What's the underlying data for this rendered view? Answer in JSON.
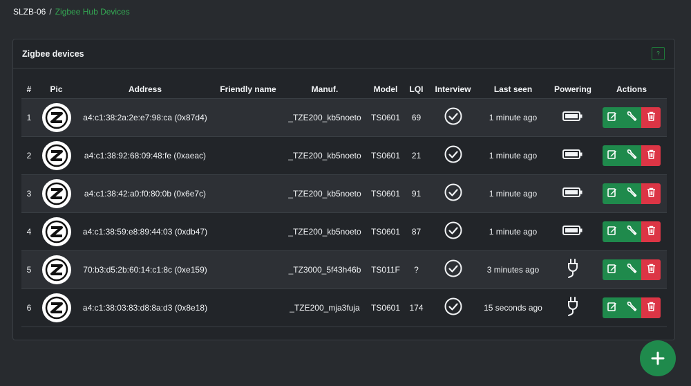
{
  "breadcrumb": {
    "root": "SLZB-06",
    "separator": "/",
    "current": "Zigbee Hub Devices"
  },
  "card": {
    "title": "Zigbee devices",
    "help_label": "?"
  },
  "table": {
    "headers": [
      "#",
      "Pic",
      "Address",
      "Friendly name",
      "Manuf.",
      "Model",
      "LQI",
      "Interview",
      "Last seen",
      "Powering",
      "Actions"
    ],
    "rows": [
      {
        "num": "1",
        "address": "a4:c1:38:2a:2e:e7:98:ca (0x87d4)",
        "friendly_name": "",
        "manuf": "_TZE200_kb5noeto",
        "model": "TS0601",
        "lqi": "69",
        "interview": "check-circle-icon",
        "last_seen": "1 minute ago",
        "powering": "battery-icon"
      },
      {
        "num": "2",
        "address": "a4:c1:38:92:68:09:48:fe (0xaeac)",
        "friendly_name": "",
        "manuf": "_TZE200_kb5noeto",
        "model": "TS0601",
        "lqi": "21",
        "interview": "check-circle-icon",
        "last_seen": "1 minute ago",
        "powering": "battery-icon"
      },
      {
        "num": "3",
        "address": "a4:c1:38:42:a0:f0:80:0b (0x6e7c)",
        "friendly_name": "",
        "manuf": "_TZE200_kb5noeto",
        "model": "TS0601",
        "lqi": "91",
        "interview": "check-circle-icon",
        "last_seen": "1 minute ago",
        "powering": "battery-icon"
      },
      {
        "num": "4",
        "address": "a4:c1:38:59:e8:89:44:03 (0xdb47)",
        "friendly_name": "",
        "manuf": "_TZE200_kb5noeto",
        "model": "TS0601",
        "lqi": "87",
        "interview": "check-circle-icon",
        "last_seen": "1 minute ago",
        "powering": "battery-icon"
      },
      {
        "num": "5",
        "address": "70:b3:d5:2b:60:14:c1:8c (0xe159)",
        "friendly_name": "",
        "manuf": "_TZ3000_5f43h46b",
        "model": "TS011F",
        "lqi": "?",
        "interview": "check-circle-icon",
        "last_seen": "3 minutes ago",
        "powering": "plug-icon"
      },
      {
        "num": "6",
        "address": "a4:c1:38:03:83:d8:8a:d3 (0x8e18)",
        "friendly_name": "",
        "manuf": "_TZE200_mja3fuja",
        "model": "TS0601",
        "lqi": "174",
        "interview": "check-circle-icon",
        "last_seen": "15 seconds ago",
        "powering": "plug-icon"
      }
    ]
  },
  "colors": {
    "accent": "#1f8a4c",
    "breadcrumb_active": "#34a853",
    "danger": "#dc3545",
    "background": "#282b2f",
    "card": "#222529"
  },
  "icons": {
    "avatar": "zigbee-logo-icon",
    "edit": "edit-icon",
    "settings": "wrench-icon",
    "delete": "trash-icon",
    "add": "plus-icon"
  }
}
